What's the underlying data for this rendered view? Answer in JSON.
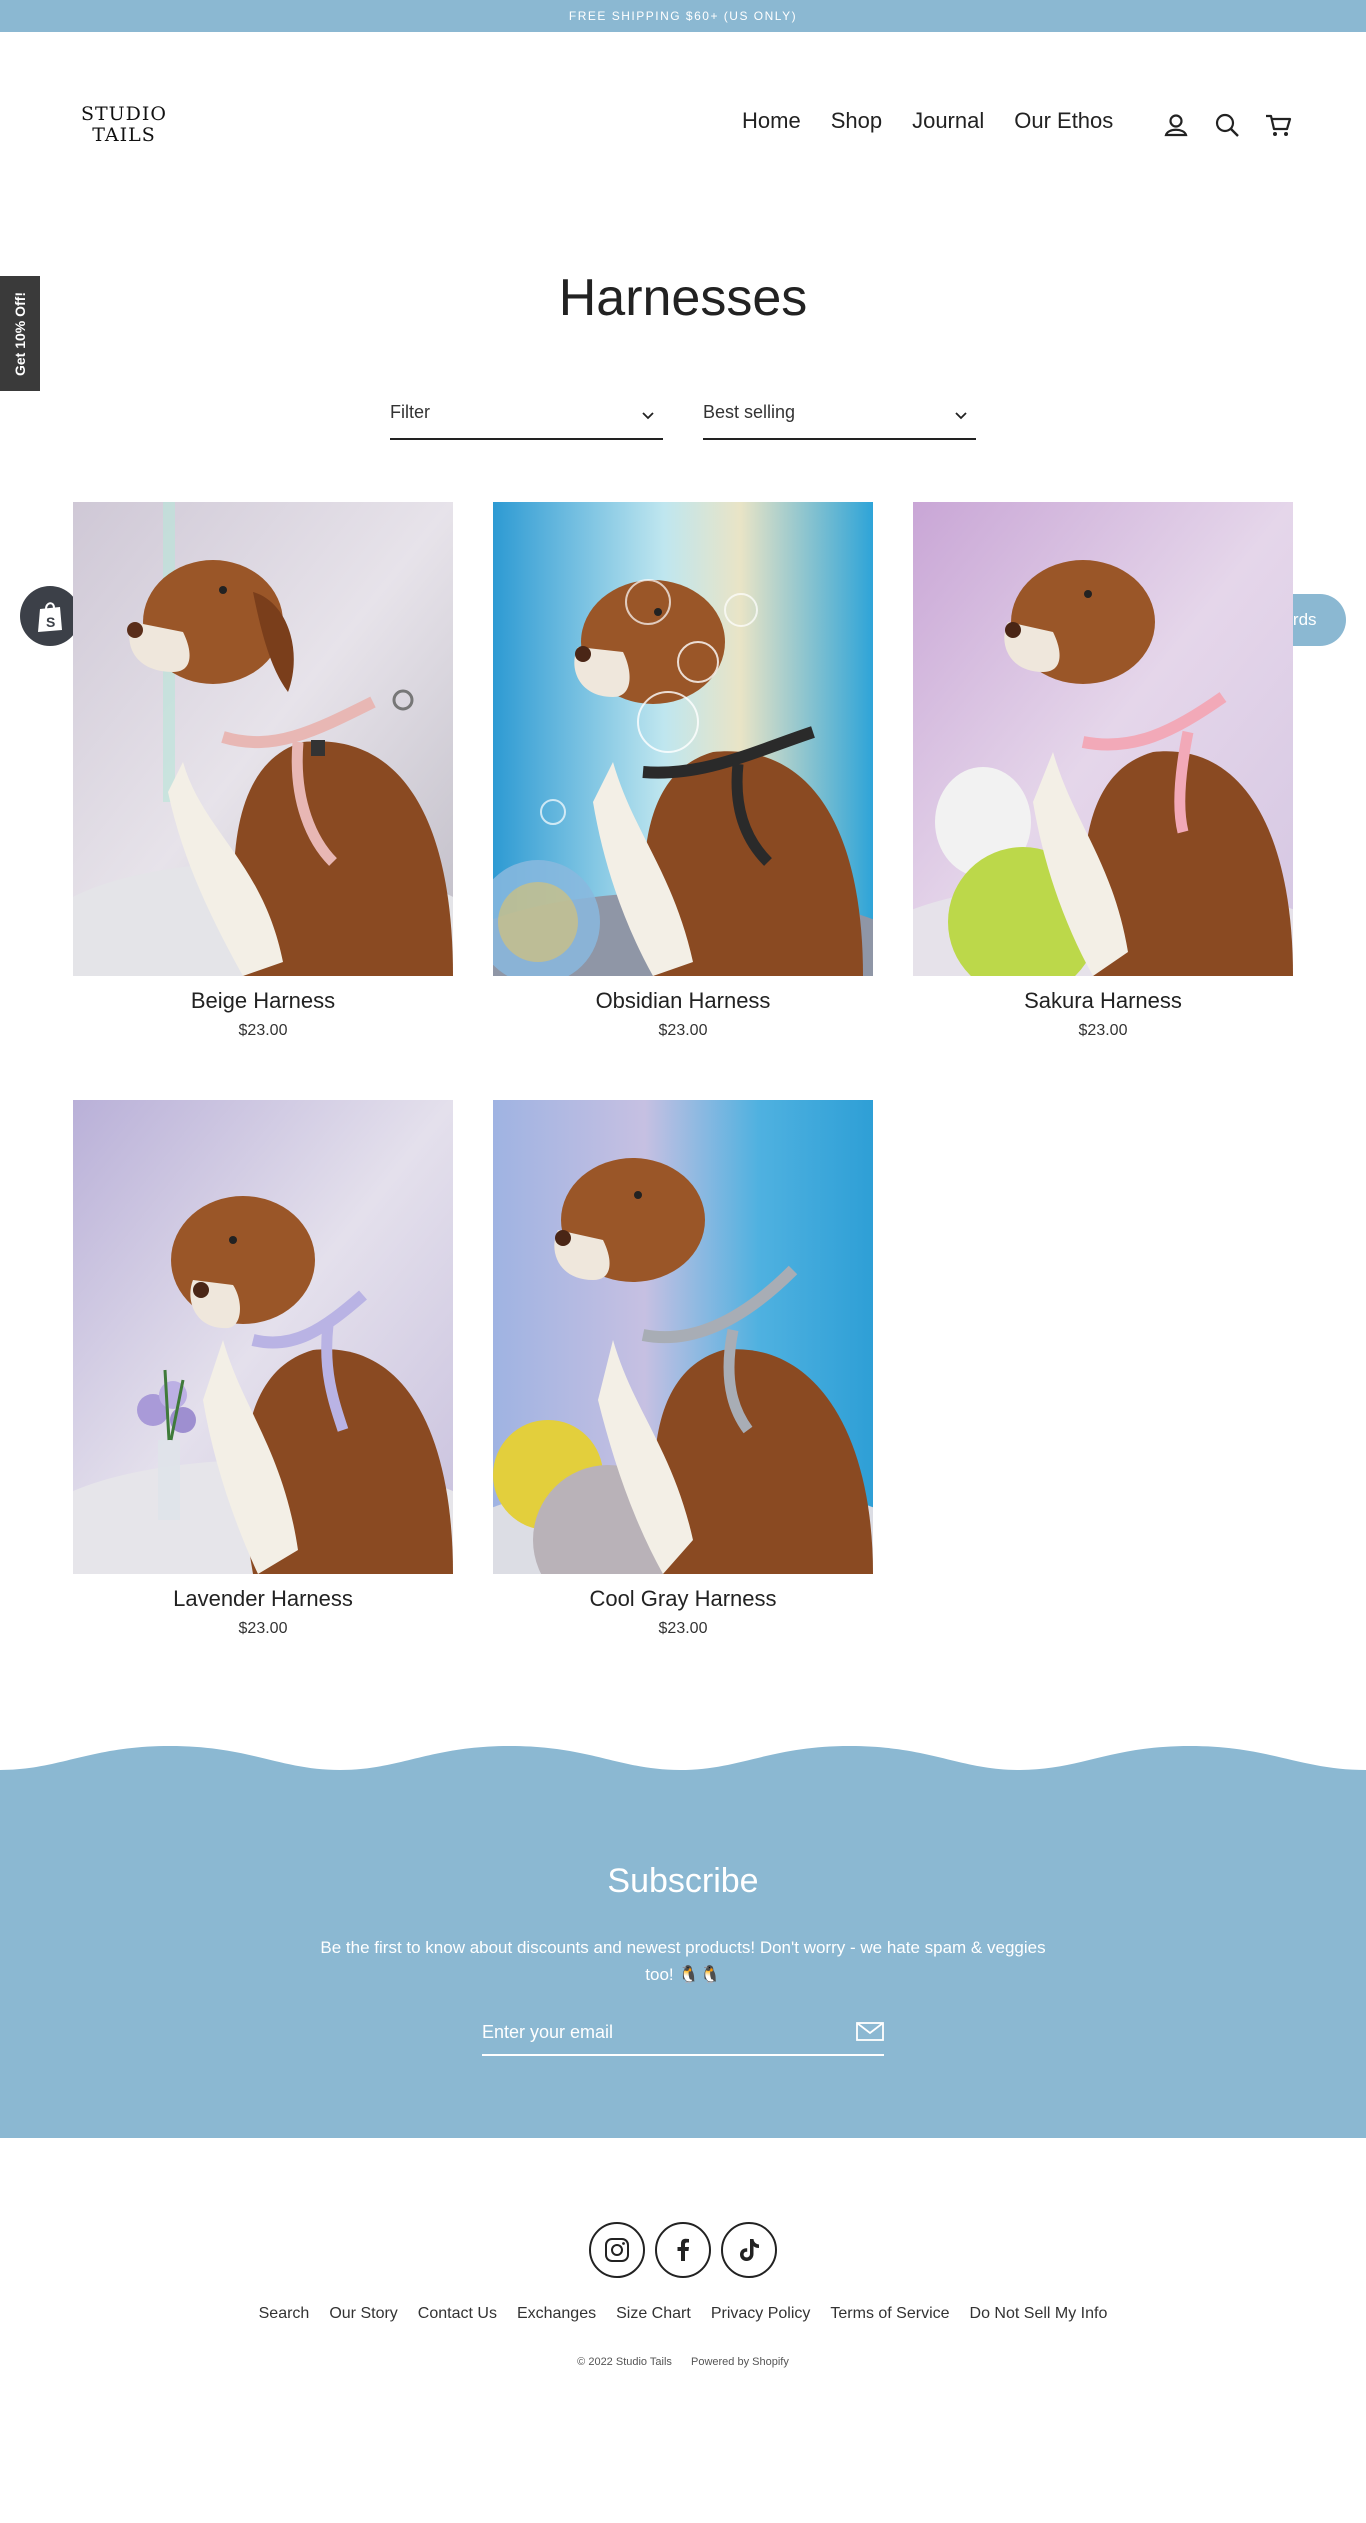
{
  "announcement": "FREE SHIPPING $60+ (US ONLY)",
  "logo": {
    "line1": "STUDIO",
    "line2": "TAILS"
  },
  "nav": {
    "items": [
      {
        "label": "Home"
      },
      {
        "label": "Shop"
      },
      {
        "label": "Journal"
      },
      {
        "label": "Our Ethos"
      }
    ],
    "icons": [
      "account-icon",
      "search-icon",
      "cart-icon"
    ]
  },
  "side_tab": "Get 10% Off!",
  "rewards_label": "Rewards",
  "collection": {
    "title": "Harnesses",
    "filter_label": "Filter",
    "sort_label": "Best selling"
  },
  "products": [
    {
      "name": "Beige Harness",
      "price": "$23.00",
      "harness_color": "#e8b7b4",
      "backdrop": "#d9d4de"
    },
    {
      "name": "Obsidian Harness",
      "price": "$23.00",
      "harness_color": "#2a2a2a",
      "backdrop": "#3fa8d8"
    },
    {
      "name": "Sakura Harness",
      "price": "$23.00",
      "harness_color": "#f2a9b8",
      "backdrop": "#d7bedc"
    },
    {
      "name": "Lavender Harness",
      "price": "$23.00",
      "harness_color": "#b9b3e4",
      "backdrop": "#c8bedf"
    },
    {
      "name": "Cool Gray Harness",
      "price": "$23.00",
      "harness_color": "#a8adb5",
      "backdrop": "#6fb8df"
    }
  ],
  "subscribe": {
    "title": "Subscribe",
    "text": "Be the first to know about discounts and newest products! Don't worry - we hate spam & veggies too! 🐧🐧",
    "email_placeholder": "Enter your email"
  },
  "social": [
    "instagram-icon",
    "facebook-icon",
    "tiktok-icon"
  ],
  "footer_links": [
    {
      "label": "Search"
    },
    {
      "label": "Our Story"
    },
    {
      "label": "Contact Us"
    },
    {
      "label": "Exchanges"
    },
    {
      "label": "Size Chart"
    },
    {
      "label": "Privacy Policy"
    },
    {
      "label": "Terms of Service"
    },
    {
      "label": "Do Not Sell My Info"
    }
  ],
  "copyright": "© 2022 Studio Tails",
  "powered_by": "Powered by Shopify",
  "colors": {
    "accent": "#8bb8d2",
    "side_tab": "#3a3a3a",
    "text": "#222222"
  }
}
